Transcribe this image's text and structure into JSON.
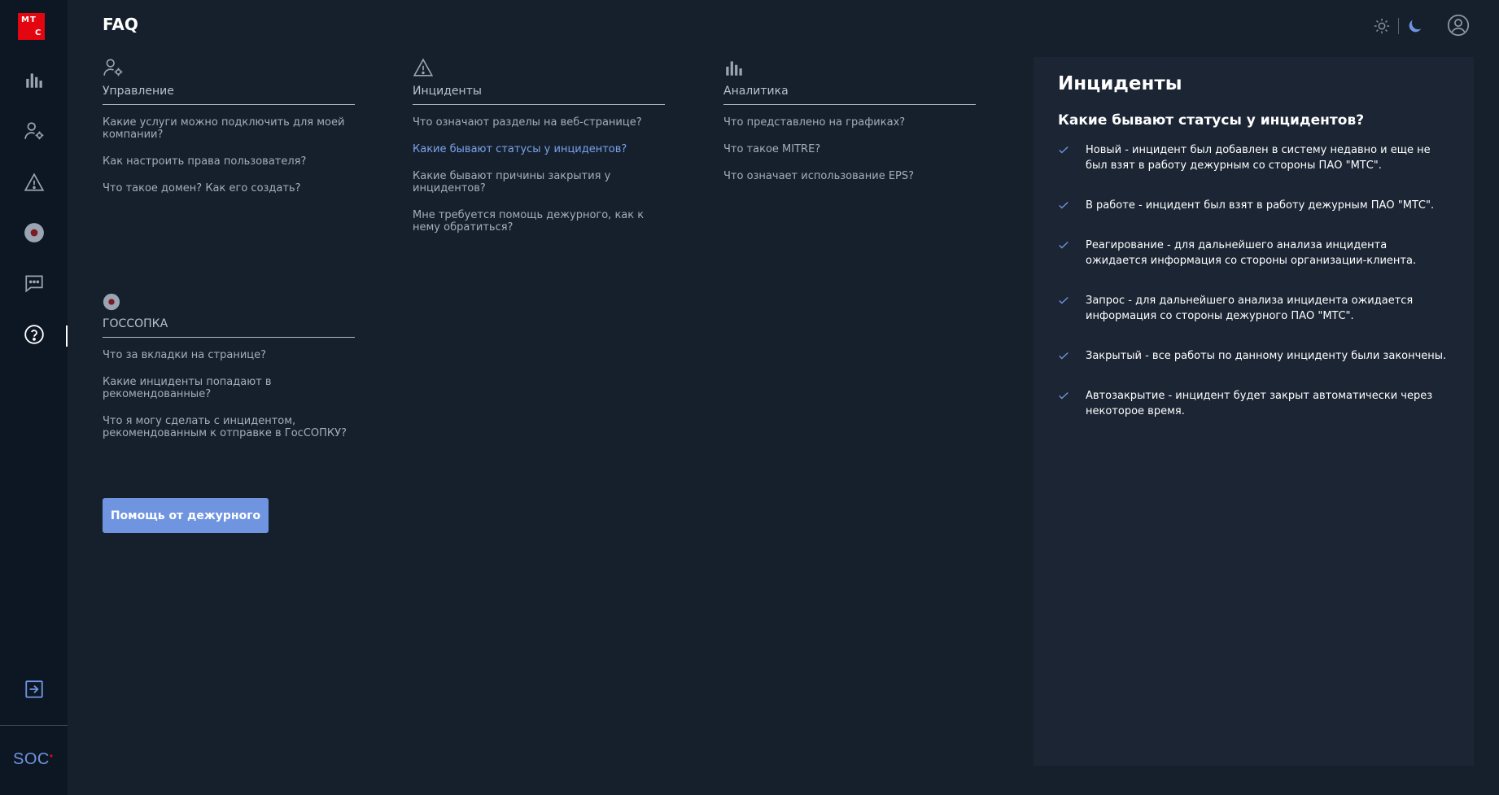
{
  "app": {
    "logo_letters": [
      "М",
      "Т",
      "С"
    ],
    "brand": "SOC",
    "brand_accent_color": "#e30611"
  },
  "page": {
    "title": "FAQ"
  },
  "nav": [
    {
      "name": "analytics",
      "icon": "bar-chart-icon"
    },
    {
      "name": "management",
      "icon": "user-gear-icon"
    },
    {
      "name": "incidents",
      "icon": "warning-icon"
    },
    {
      "name": "gossopka",
      "icon": "target-icon"
    },
    {
      "name": "chat",
      "icon": "chat-icon"
    },
    {
      "name": "faq",
      "icon": "help-icon",
      "active": true
    }
  ],
  "sections": {
    "management": {
      "icon": "user-gear-icon",
      "title": "Управление",
      "questions": [
        "Какие услуги можно подключить для моей компании?",
        "Как настроить права пользователя?",
        "Что такое домен? Как его создать?"
      ]
    },
    "incidents": {
      "icon": "warning-icon",
      "title": "Инциденты",
      "questions": [
        "Что означают разделы на веб-странице?",
        "Какие бывают статусы у инцидентов?",
        "Какие бывают причины закрытия у инцидентов?",
        "Мне требуется помощь дежурного, как к нему обратиться?"
      ],
      "active_index": 1
    },
    "analytics": {
      "icon": "bar-chart-icon",
      "title": "Аналитика",
      "questions": [
        "Что представлено на графиках?",
        "Что такое MITRE?",
        "Что означает использование EPS?"
      ]
    },
    "gossopka": {
      "icon": "target-icon",
      "title": "ГОССОПКА",
      "questions": [
        "Что за вкладки на странице?",
        "Какие инциденты попадают в рекомендованные?",
        "Что я могу сделать с инцидентом, рекомендованным к отправке в ГосСОПКУ?"
      ]
    }
  },
  "help_button": {
    "label": "Помощь от дежурного"
  },
  "answer": {
    "title": "Инциденты",
    "question": "Какие бывают статусы у инцидентов?",
    "items": [
      "Новый - инцидент был добавлен в систему недавно и еще не был взят в работу дежурным со стороны ПАО \"МТС\".",
      "В работе - инцидент был взят в работу дежурным ПАО \"МТС\".",
      "Реагирование - для дальнейшего анализа инцидента ожидается информация со стороны организации-клиента.",
      "Запрос - для дальнейшего анализа инцидента ожидается информация со стороны дежурного ПАО \"МТС\".",
      "Закрытый - все работы по данному инциденту были закончены.",
      "Автозакрытие - инцидент будет закрыт автоматически через некоторое время."
    ]
  },
  "colors": {
    "accent": "#6f94e0",
    "background": "#16202d",
    "sidebar": "#0d1723",
    "panel": "#1b2533"
  }
}
